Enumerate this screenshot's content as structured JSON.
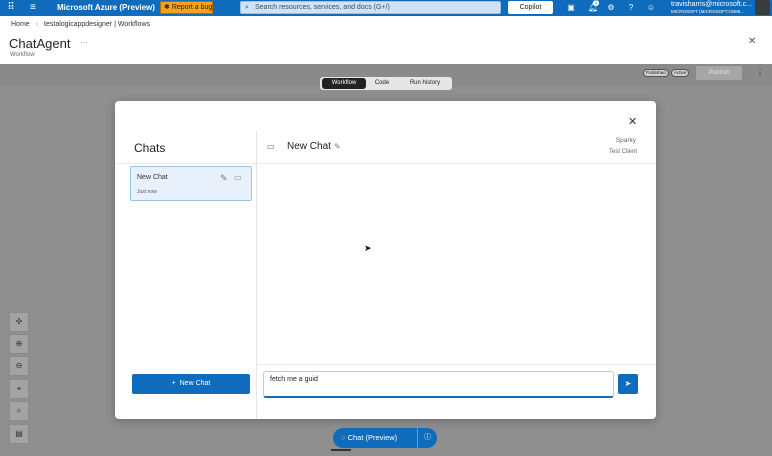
{
  "topbar": {
    "app_title": "Microsoft Azure (Preview)",
    "report_bug": "Report a bug",
    "search_placeholder": "Search resources, services, and docs (G+/)",
    "copilot": "Copilot",
    "notification_count": "1",
    "user_email": "travisharris@microsoft.c...",
    "user_tenant": "MICROSOFT (MICROSOFT.ONMI..."
  },
  "header": {
    "breadcrumb": [
      "Home",
      "testalogicappdesigner | Workflows"
    ],
    "title": "ChatAgent",
    "subtitle": "Workflow",
    "more": "···"
  },
  "designer": {
    "tabs": [
      {
        "label": "Workflow",
        "active": true
      },
      {
        "label": "Code",
        "active": false
      },
      {
        "label": "Run history",
        "active": false
      }
    ],
    "status_published": "Published",
    "status_active": "Active",
    "publish_label": "Publish"
  },
  "left_toolbar": [
    "pan-icon",
    "zoom-in-icon",
    "zoom-out-icon",
    "fit-view-icon",
    "search-icon",
    "minimap-icon"
  ],
  "chat_dialog": {
    "chats_heading": "Chats",
    "chat_list": [
      {
        "title": "New Chat",
        "time": "Just now"
      }
    ],
    "conversation_title": "New Chat",
    "agent_name": "Sparky",
    "agent_client": "Test Client",
    "new_chat_button": "New Chat",
    "input_value": "fetch me a guid"
  },
  "bottom": {
    "chat_preview_label": "Chat (Preview)"
  },
  "colors": {
    "azure_blue": "#0f6cbd",
    "bug_orange": "#f7a21b",
    "overlay_gray": "#8f8f8f"
  }
}
